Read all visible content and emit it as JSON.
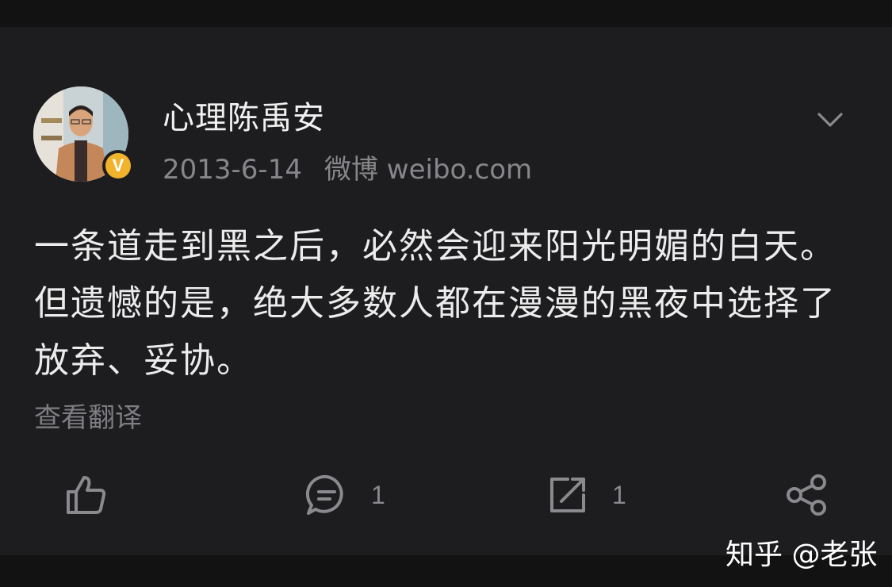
{
  "post": {
    "username": "心理陈禹安",
    "verified_badge": "V",
    "date": "2013-6-14",
    "source": "微博 weibo.com",
    "content": "一条道走到黑之后，必然会迎来阳光明媚的白天。但遗憾的是，绝大多数人都在漫漫的黑夜中选择了放弃、妥协。",
    "translate_label": "查看翻译"
  },
  "actions": {
    "like_icon": "thumbs-up-icon",
    "comment_icon": "comment-icon",
    "comment_count": "1",
    "repost_icon": "repost-icon",
    "repost_count": "1",
    "share_icon": "share-icon"
  },
  "watermark": "知乎 @老张",
  "colors": {
    "background": "#121212",
    "card": "#1d1d1f",
    "badge": "#f2b32c",
    "text_primary": "#ececec",
    "text_secondary": "#87878b"
  }
}
